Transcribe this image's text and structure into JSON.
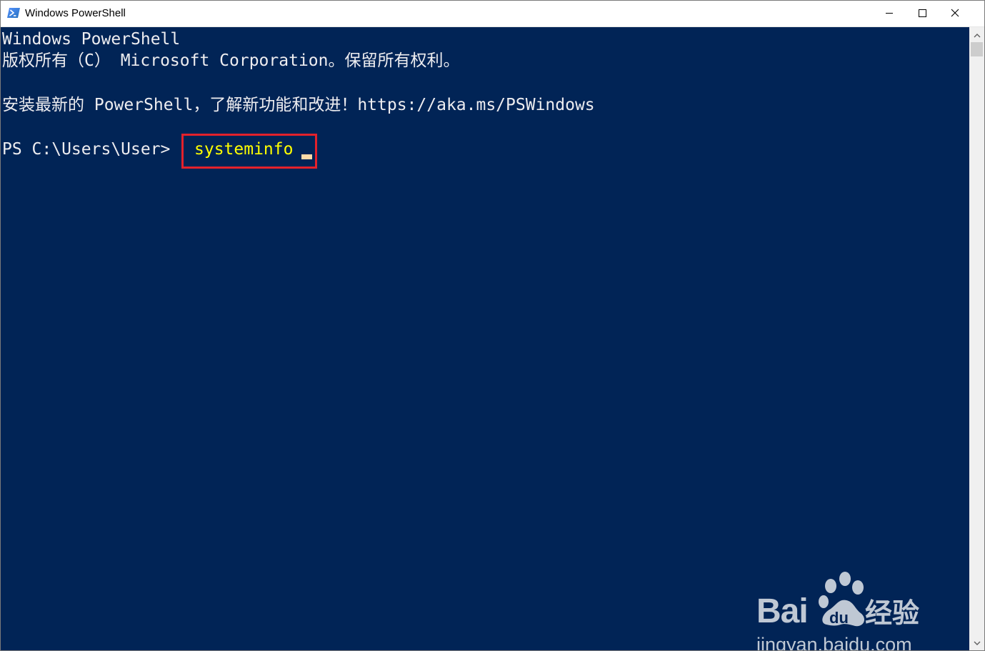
{
  "window": {
    "title": "Windows PowerShell",
    "icon": "powershell-icon",
    "controls": {
      "minimize_icon": "minimize-icon",
      "maximize_icon": "maximize-icon",
      "close_icon": "close-icon"
    }
  },
  "console": {
    "background_color": "#012456",
    "text_color": "#eeedf0",
    "lines": [
      "Windows PowerShell",
      "版权所有（C） Microsoft Corporation。保留所有权利。",
      "安装最新的 PowerShell，了解新功能和改进！https://aka.ms/PSWindows"
    ],
    "prompt": "PS C:\\Users\\User>",
    "command": "systeminfo",
    "command_color": "#ffff00",
    "highlight_color": "#e3212b"
  },
  "watermark": {
    "brand": "Bai",
    "brand_cn": "经验",
    "url": "jingyan.baidu.com"
  }
}
